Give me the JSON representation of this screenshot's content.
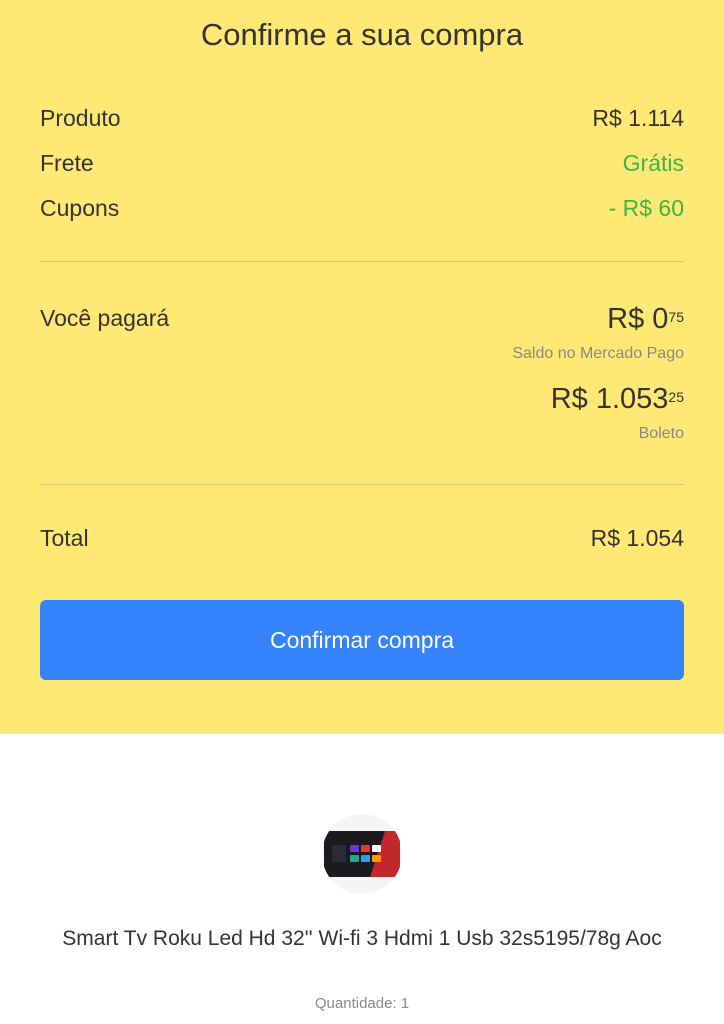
{
  "summary": {
    "title": "Confirme a sua compra",
    "rows": [
      {
        "label": "Produto",
        "value": "R$ 1.114"
      },
      {
        "label": "Frete",
        "value": "Grátis"
      },
      {
        "label": "Cupons",
        "value": "- R$ 60"
      }
    ],
    "payment": {
      "label": "Você pagará",
      "methods": [
        {
          "amount_main": "R$ 0",
          "amount_cents": "75",
          "method": "Saldo no Mercado Pago"
        },
        {
          "amount_main": "R$ 1.053",
          "amount_cents": "25",
          "method": "Boleto"
        }
      ]
    },
    "total": {
      "label": "Total",
      "value": "R$ 1.054"
    },
    "confirm_button": "Confirmar compra"
  },
  "product": {
    "thumbnail_icon": "tv-thumbnail-icon",
    "name": "Smart Tv Roku Led Hd 32'' Wi-fi 3 Hdmi 1 Usb 32s5195/78g Aoc",
    "quantity": "Quantidade: 1"
  },
  "colors": {
    "summary_bg": "#FFE873",
    "accent_button": "#3483FA",
    "positive_green": "#3BB54A",
    "text": "#333333",
    "muted_text": "#888888"
  }
}
